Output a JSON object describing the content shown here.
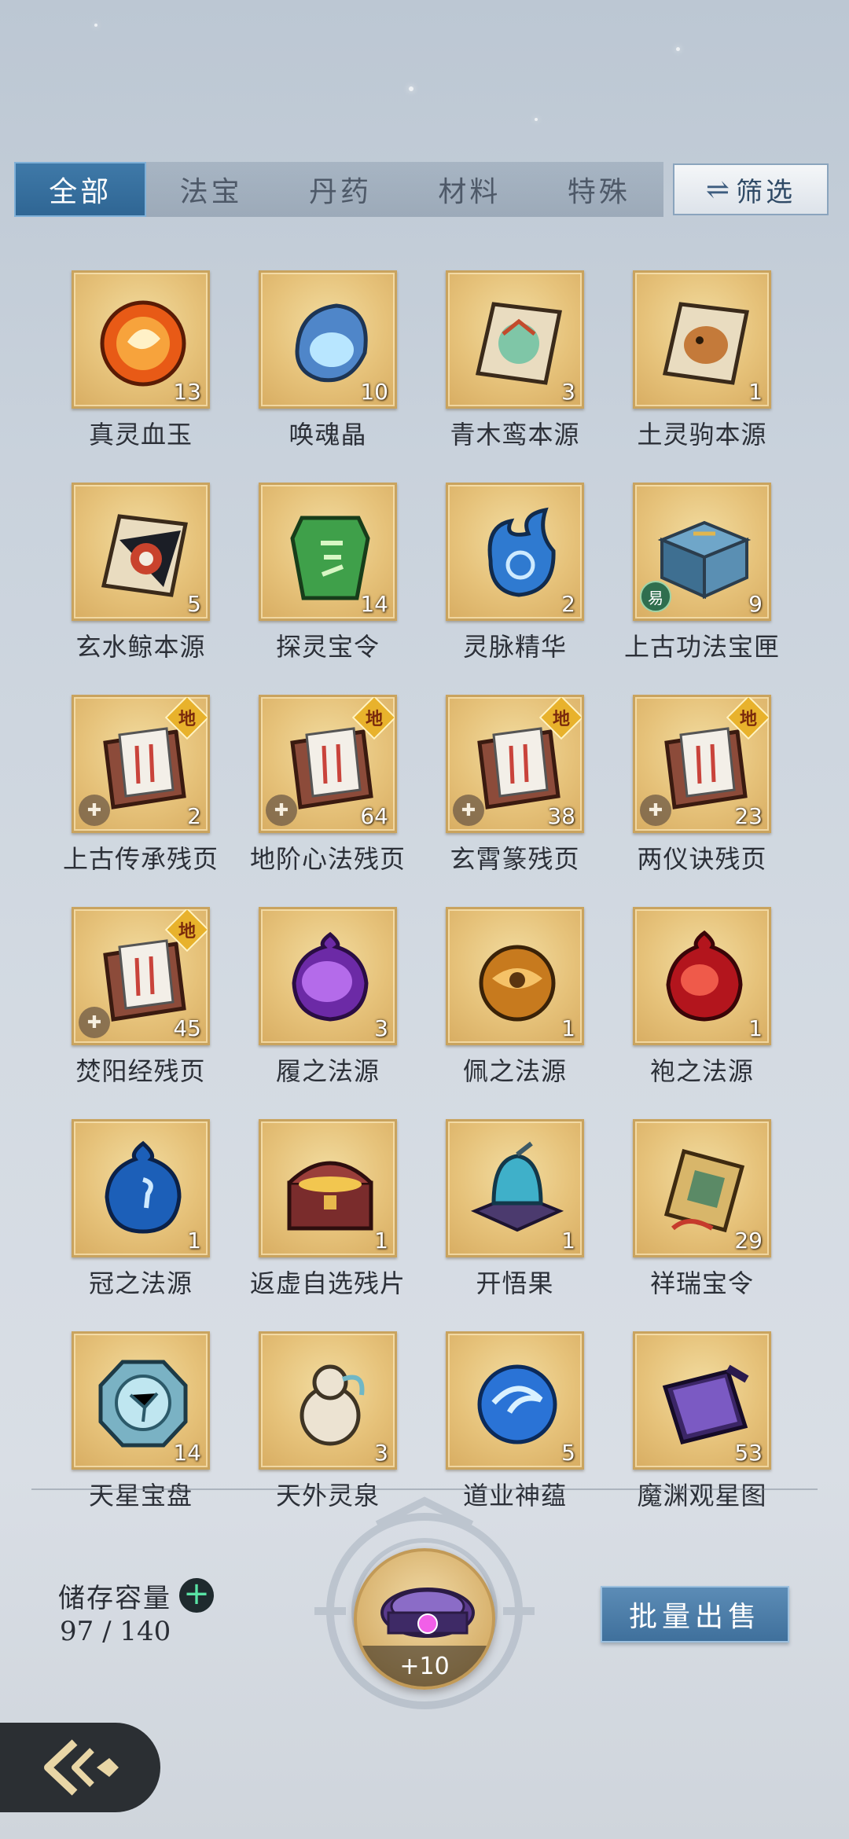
{
  "tabs": {
    "all": "全部",
    "treasure": "法宝",
    "elixir": "丹药",
    "material": "材料",
    "special": "特殊"
  },
  "filter": {
    "icon": "⇌",
    "label": "筛选"
  },
  "items": [
    {
      "name": "真灵血玉",
      "count": "13",
      "icon": "blood-jade-icon"
    },
    {
      "name": "唤魂晶",
      "count": "10",
      "icon": "soul-crystal-icon"
    },
    {
      "name": "青木鸾本源",
      "count": "3",
      "icon": "green-phoenix-origin-icon"
    },
    {
      "name": "土灵驹本源",
      "count": "1",
      "icon": "earth-steed-origin-icon"
    },
    {
      "name": "玄水鲸本源",
      "count": "5",
      "icon": "water-whale-origin-icon"
    },
    {
      "name": "探灵宝令",
      "count": "14",
      "icon": "spirit-token-icon"
    },
    {
      "name": "灵脉精华",
      "count": "2",
      "icon": "spirit-essence-icon"
    },
    {
      "name": "上古功法宝匣",
      "count": "9",
      "icon": "ancient-chest-icon",
      "tag": "易"
    },
    {
      "name": "上古传承残页",
      "count": "2",
      "icon": "scroll-fragment-icon",
      "grade": "地",
      "puzzle": "✚"
    },
    {
      "name": "地阶心法残页",
      "count": "64",
      "icon": "scroll-fragment-icon",
      "grade": "地",
      "puzzle": "✚"
    },
    {
      "name": "玄霄篆残页",
      "count": "38",
      "icon": "scroll-fragment-icon",
      "grade": "地",
      "puzzle": "✚"
    },
    {
      "name": "两仪诀残页",
      "count": "23",
      "icon": "scroll-fragment-icon",
      "grade": "地",
      "puzzle": "✚"
    },
    {
      "name": "焚阳经残页",
      "count": "45",
      "icon": "scroll-fragment-icon",
      "grade": "地",
      "puzzle": "✚"
    },
    {
      "name": "履之法源",
      "count": "3",
      "icon": "purple-orb-icon"
    },
    {
      "name": "佩之法源",
      "count": "1",
      "icon": "amber-orb-icon"
    },
    {
      "name": "袍之法源",
      "count": "1",
      "icon": "red-orb-icon"
    },
    {
      "name": "冠之法源",
      "count": "1",
      "icon": "blue-orb-icon"
    },
    {
      "name": "返虚自选残片",
      "count": "1",
      "icon": "treasure-chest-icon"
    },
    {
      "name": "开悟果",
      "count": "1",
      "icon": "enlightenment-fruit-icon"
    },
    {
      "name": "祥瑞宝令",
      "count": "29",
      "icon": "auspicious-token-icon"
    },
    {
      "name": "天星宝盘",
      "count": "14",
      "icon": "star-disc-icon"
    },
    {
      "name": "天外灵泉",
      "count": "3",
      "icon": "spring-gourd-icon"
    },
    {
      "name": "道业神蕴",
      "count": "5",
      "icon": "dao-essence-icon"
    },
    {
      "name": "魔渊观星图",
      "count": "53",
      "icon": "star-map-scroll-icon"
    }
  ],
  "storage": {
    "label": "储存容量",
    "add": "+",
    "value": "97 / 140"
  },
  "center_item": {
    "label": "+10",
    "icon": "purple-gem-bracelet-icon"
  },
  "sell_button": "批量出售",
  "colors": {
    "active_tab": "#3f79a8",
    "tile_gold": "#e6c27a",
    "accent_green": "#59e3a5"
  }
}
